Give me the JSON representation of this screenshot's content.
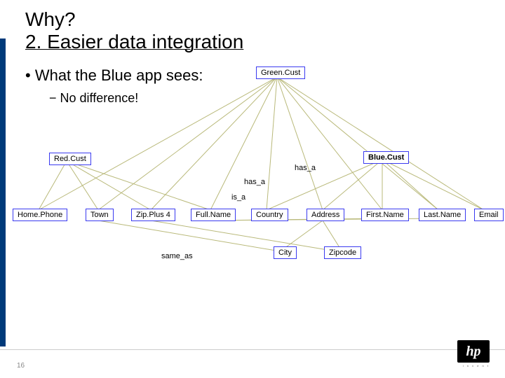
{
  "title": {
    "line1": "Why?",
    "line2": "2. Easier data integration"
  },
  "bullet": "• What the Blue app sees:",
  "subbullet": "− No difference!",
  "pagenum": "16",
  "logo": {
    "text": "hp",
    "tagline": "i n v e n t"
  },
  "nodes": {
    "green": {
      "label": "Green.Cust"
    },
    "red": {
      "label": "Red.Cust"
    },
    "blue": {
      "label": "Blue.Cust"
    },
    "home": {
      "label": "Home.Phone"
    },
    "town": {
      "label": "Town"
    },
    "zip4": {
      "label": "Zip.Plus 4"
    },
    "fullname": {
      "label": "Full.Name"
    },
    "country": {
      "label": "Country"
    },
    "address": {
      "label": "Address"
    },
    "firstn": {
      "label": "First.Name"
    },
    "lastn": {
      "label": "Last.Name"
    },
    "email": {
      "label": "Email"
    },
    "city": {
      "label": "City"
    },
    "zipcode": {
      "label": "Zipcode"
    }
  },
  "rels": {
    "has_a1": "has_a",
    "has_a2": "has_a",
    "is_a": "is_a",
    "same_as": "same_as"
  }
}
